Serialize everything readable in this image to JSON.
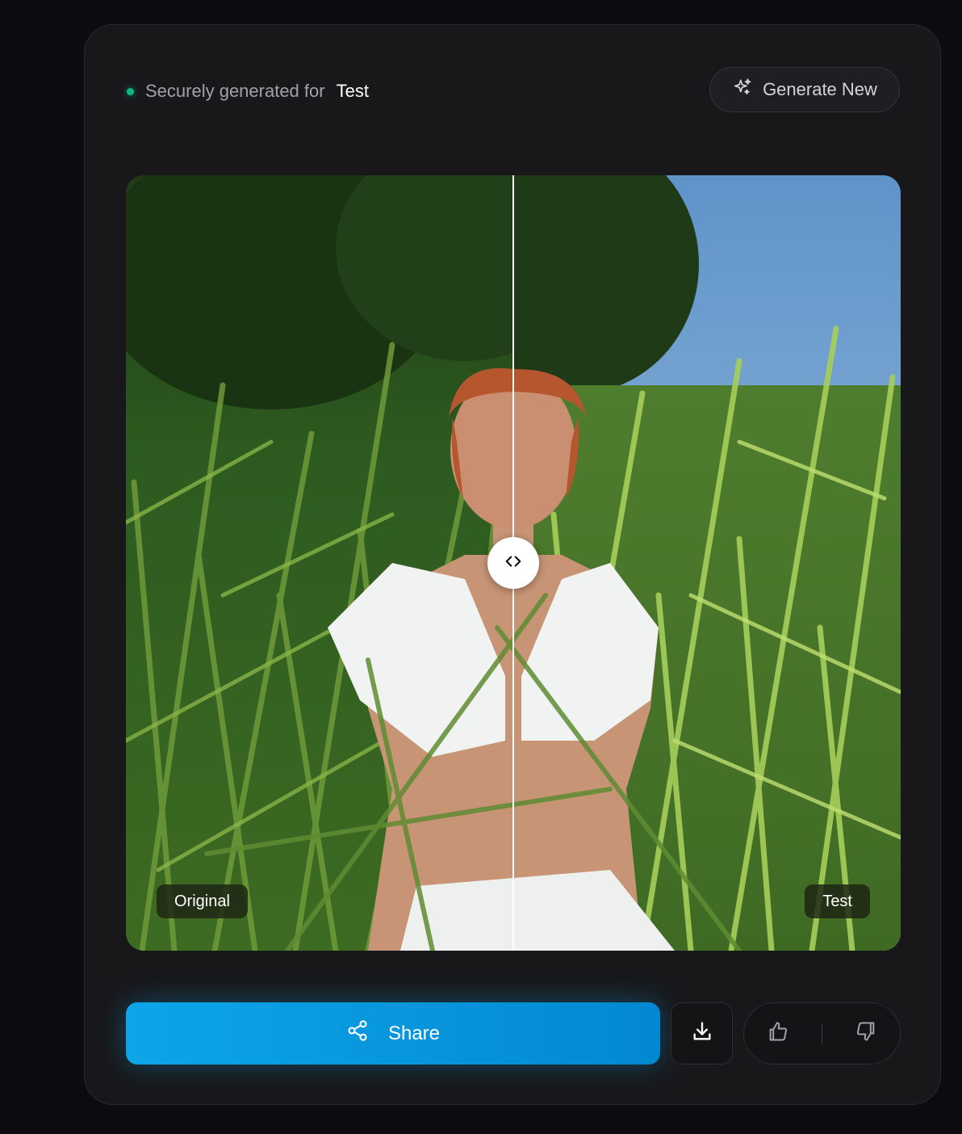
{
  "header": {
    "status_text": "Securely generated for",
    "status_name": "Test",
    "generate_label": "Generate New"
  },
  "comparison": {
    "left_label": "Original",
    "right_label": "Test",
    "slider_position": 0.5
  },
  "actions": {
    "share_label": "Share"
  },
  "colors": {
    "status_dot": "#10b981",
    "share_accent": "#0ea5e9",
    "card_bg": "#18181b",
    "page_bg": "#0b0b10"
  },
  "icons": {
    "generate": "sparkles-icon",
    "handle": "code-arrows-icon",
    "share": "share-nodes-icon",
    "download": "download-icon",
    "like": "thumbs-up-icon",
    "dislike": "thumbs-down-icon"
  }
}
